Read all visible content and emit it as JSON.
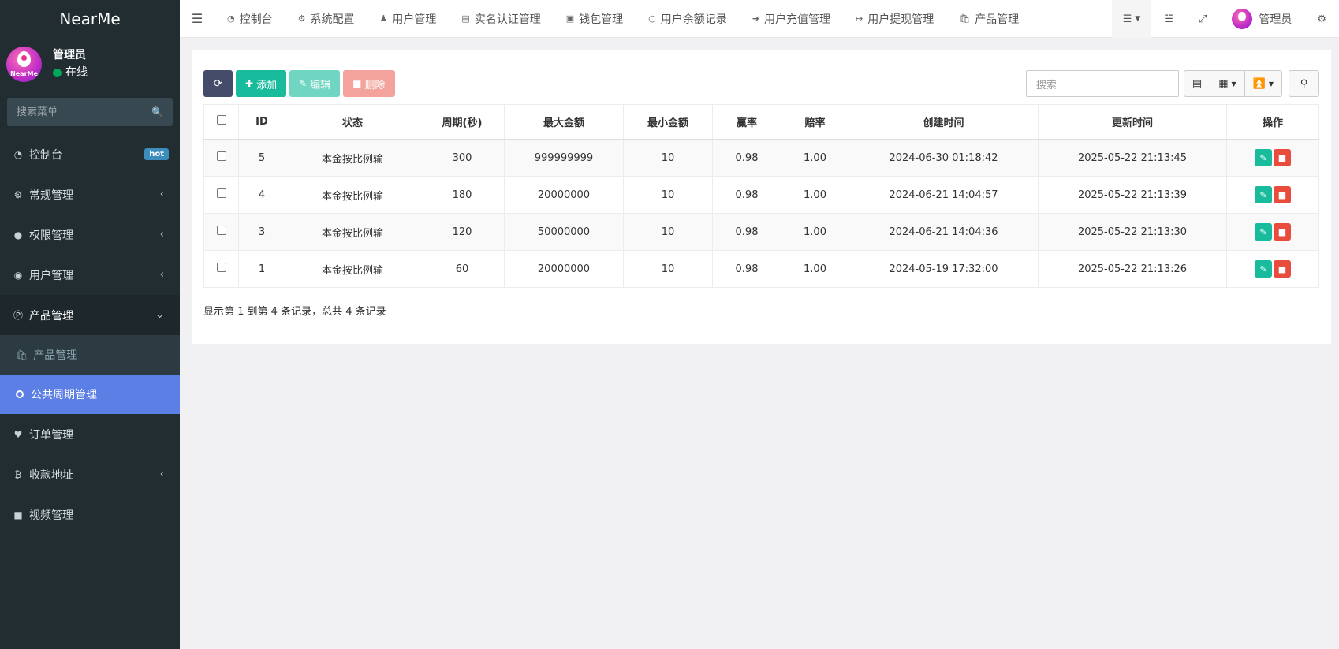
{
  "app": {
    "brand": "NearMe"
  },
  "user": {
    "name": "管理员",
    "status": "在线",
    "avatar_text": "NearMe"
  },
  "sidebar": {
    "search_placeholder": "搜索菜单",
    "items": [
      {
        "label": "控制台",
        "icon": "dashboard-icon",
        "badge": "hot"
      },
      {
        "label": "常规管理",
        "icon": "cogs-icon"
      },
      {
        "label": "权限管理",
        "icon": "group-icon"
      },
      {
        "label": "用户管理",
        "icon": "user-circle-icon"
      },
      {
        "label": "产品管理",
        "icon": "product-p-icon"
      },
      {
        "label": "订单管理",
        "icon": "heartbeat-icon"
      },
      {
        "label": "收款地址",
        "icon": "bitcoin-icon"
      },
      {
        "label": "视频管理",
        "icon": "video-camera-icon"
      }
    ],
    "submenu": [
      {
        "label": "产品管理",
        "icon": "shopping-bag-icon"
      },
      {
        "label": "公共周期管理",
        "icon": "circle-icon"
      }
    ]
  },
  "topnav": {
    "tabs": [
      {
        "label": "控制台",
        "icon": "dashboard-icon"
      },
      {
        "label": "系统配置",
        "icon": "gear-icon"
      },
      {
        "label": "用户管理",
        "icon": "user-icon"
      },
      {
        "label": "实名认证管理",
        "icon": "id-card-icon"
      },
      {
        "label": "钱包管理",
        "icon": "money-icon"
      },
      {
        "label": "用户余额记录",
        "icon": "circle-icon"
      },
      {
        "label": "用户充值管理",
        "icon": "sign-in-icon"
      },
      {
        "label": "用户提现管理",
        "icon": "sign-out-icon"
      },
      {
        "label": "产品管理",
        "icon": "shopping-bag-icon"
      }
    ],
    "admin_label": "管理员"
  },
  "toolbar": {
    "add": "添加",
    "edit": "编辑",
    "delete": "删除",
    "search_placeholder": "搜索"
  },
  "table": {
    "headers": [
      "ID",
      "状态",
      "周期(秒)",
      "最大金额",
      "最小金额",
      "赢率",
      "赔率",
      "创建时间",
      "更新时间",
      "操作"
    ],
    "rows": [
      {
        "id": "5",
        "status": "本金按比例输",
        "period": "300",
        "max": "999999999",
        "min": "10",
        "win": "0.98",
        "odds": "1.00",
        "created": "2024-06-30 01:18:42",
        "updated": "2025-05-22 21:13:45"
      },
      {
        "id": "4",
        "status": "本金按比例输",
        "period": "180",
        "max": "20000000",
        "min": "10",
        "win": "0.98",
        "odds": "1.00",
        "created": "2024-06-21 14:04:57",
        "updated": "2025-05-22 21:13:39"
      },
      {
        "id": "3",
        "status": "本金按比例输",
        "period": "120",
        "max": "50000000",
        "min": "10",
        "win": "0.98",
        "odds": "1.00",
        "created": "2024-06-21 14:04:36",
        "updated": "2025-05-22 21:13:30"
      },
      {
        "id": "1",
        "status": "本金按比例输",
        "period": "60",
        "max": "20000000",
        "min": "10",
        "win": "0.98",
        "odds": "1.00",
        "created": "2024-05-19 17:32:00",
        "updated": "2025-05-22 21:13:26"
      }
    ]
  },
  "pagination": {
    "summary": "显示第 1 到第 4 条记录，总共 4 条记录"
  }
}
